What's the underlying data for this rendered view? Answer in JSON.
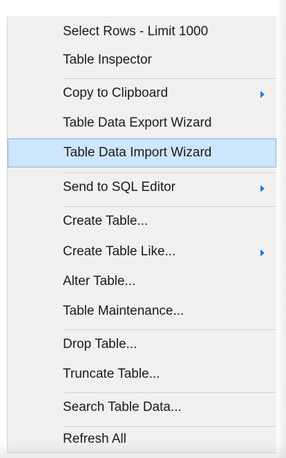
{
  "context_menu": {
    "items": [
      {
        "label": "Select Rows - Limit 1000"
      },
      {
        "label": "Table Inspector"
      },
      {
        "label": "Copy to Clipboard",
        "submenu": true
      },
      {
        "label": "Table Data Export Wizard"
      },
      {
        "label": "Table Data Import Wizard",
        "highlighted": true
      },
      {
        "label": "Send to SQL Editor",
        "submenu": true
      },
      {
        "label": "Create Table..."
      },
      {
        "label": "Create Table Like...",
        "submenu": true
      },
      {
        "label": "Alter Table..."
      },
      {
        "label": "Table Maintenance..."
      },
      {
        "label": "Drop Table..."
      },
      {
        "label": "Truncate Table..."
      },
      {
        "label": "Search Table Data..."
      },
      {
        "label": "Refresh All"
      }
    ],
    "colors": {
      "background": "#f0f0f0",
      "highlight_fill": "#cde6fb",
      "highlight_border": "#7eb4ea",
      "submenu_arrow": "#1f7bd6"
    }
  }
}
